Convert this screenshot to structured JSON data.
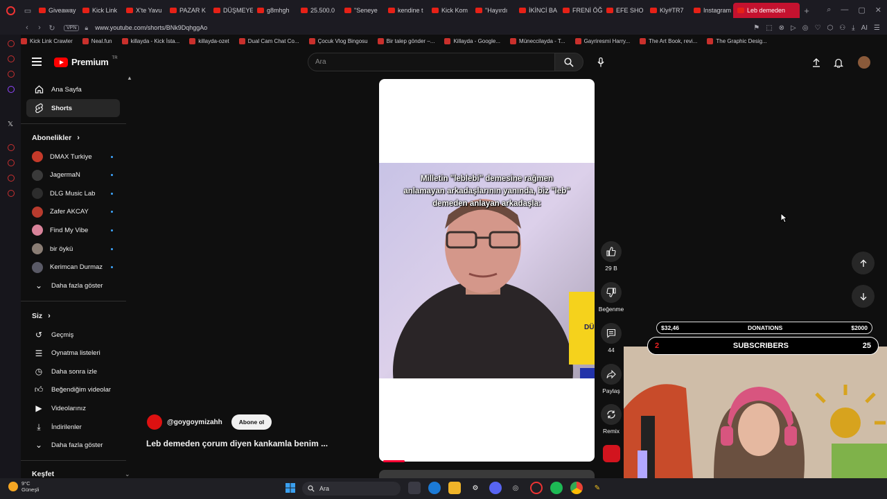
{
  "browser": {
    "tabs": [
      {
        "label": "Giveaway"
      },
      {
        "label": "Kick Link"
      },
      {
        "label": "X'te Yavu"
      },
      {
        "label": "PAZAR K"
      },
      {
        "label": "DÜŞMEYE"
      },
      {
        "label": "g8mhgh"
      },
      {
        "label": "25.500.0"
      },
      {
        "label": "\"Seneye"
      },
      {
        "label": "kendine t"
      },
      {
        "label": "Kick Kom"
      },
      {
        "label": "\"Hayırdı"
      },
      {
        "label": "İKİNCİ BA"
      },
      {
        "label": "FRENİ ÖĞ"
      },
      {
        "label": "EFE SHO"
      },
      {
        "label": "Kly#TR7"
      },
      {
        "label": "Instagram"
      },
      {
        "label": "Leb demeden"
      }
    ],
    "vpn_label": "VPN",
    "url": "www.youtube.com/shorts/BNk9DqhggAo",
    "ai_label": "AI",
    "bookmarks": [
      {
        "label": "Kick Link Crawler"
      },
      {
        "label": "Neal.fun"
      },
      {
        "label": "killayda - Kick İsta..."
      },
      {
        "label": "killayda-ozet"
      },
      {
        "label": "Dual Cam Chat Co..."
      },
      {
        "label": "Çocuk Vlog Bingosu"
      },
      {
        "label": "Bir talep gönder –..."
      },
      {
        "label": "Killayda - Google..."
      },
      {
        "label": "Müneccilayda - T..."
      },
      {
        "label": "Gayriresmi Harry..."
      },
      {
        "label": "The Art Book, revi..."
      },
      {
        "label": "The Graphic Desig..."
      }
    ]
  },
  "youtube": {
    "logo_text": "Premium",
    "logo_region": "TR",
    "search_placeholder": "Ara",
    "sidebar": {
      "main": [
        {
          "label": "Ana Sayfa",
          "icon": "home-icon"
        },
        {
          "label": "Shorts",
          "icon": "shorts-icon"
        }
      ],
      "subs_heading": "Abonelikler",
      "subs": [
        {
          "label": "DMAX Turkiye",
          "avatar_color": "#c43a2a"
        },
        {
          "label": "JagermaN",
          "avatar_color": "#3a3a3a"
        },
        {
          "label": "DLG Music Lab",
          "avatar_color": "#2d2d2d"
        },
        {
          "label": "Zafer AKCAY",
          "avatar_color": "#b83b2e"
        },
        {
          "label": "Find My Vibe",
          "avatar_color": "#d9839a"
        },
        {
          "label": "bir öykü",
          "avatar_color": "#8a7d74"
        },
        {
          "label": "Kerimcan Durmaz",
          "avatar_color": "#5a5a66"
        }
      ],
      "subs_more": "Daha fazla göster",
      "you_heading": "Siz",
      "you": [
        {
          "label": "Geçmiş",
          "icon": "history-icon"
        },
        {
          "label": "Oynatma listeleri",
          "icon": "playlist-icon"
        },
        {
          "label": "Daha sonra izle",
          "icon": "watch-later-icon"
        },
        {
          "label": "Beğendiğim videolar",
          "icon": "liked-icon"
        },
        {
          "label": "Videolarınız",
          "icon": "your-videos-icon"
        },
        {
          "label": "İndirilenler",
          "icon": "download-icon"
        }
      ],
      "you_more": "Daha fazla göster",
      "explore_heading": "Keşfet"
    },
    "short": {
      "caption": "Milletin \"leblebi\" demesine rağmen anlamayan arkadaşlarının yanında, biz \"leb\" demeden anlayan arkadaşla:",
      "side_text": "DÜ",
      "channel": "@goygoymizahh",
      "subscribe_label": "Abone ol",
      "title": "Leb demeden çorum diyen kankamla benim ...",
      "progress": 0.1
    },
    "actions": {
      "like_count": "29 B",
      "dislike_label": "Beğenme",
      "comment_count": "44",
      "share_label": "Paylaş",
      "remix_label": "Remix"
    }
  },
  "overlay": {
    "donations_left": "$32,46",
    "donations_label": "DONATIONS",
    "donations_right": "$2000",
    "subs_left": "2",
    "subs_label": "SUBSCRIBERS",
    "subs_right": "25"
  },
  "taskbar": {
    "temp": "9°C",
    "weather": "Güneşli",
    "search_label": "Ara"
  }
}
